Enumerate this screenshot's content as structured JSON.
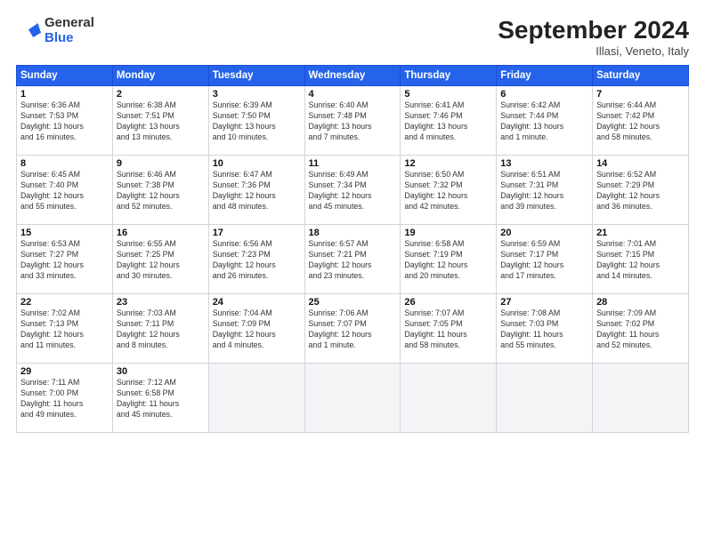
{
  "logo": {
    "general": "General",
    "blue": "Blue"
  },
  "header": {
    "title": "September 2024",
    "subtitle": "Illasi, Veneto, Italy"
  },
  "days_of_week": [
    "Sunday",
    "Monday",
    "Tuesday",
    "Wednesday",
    "Thursday",
    "Friday",
    "Saturday"
  ],
  "weeks": [
    [
      {
        "day": "1",
        "info": "Sunrise: 6:36 AM\nSunset: 7:53 PM\nDaylight: 13 hours\nand 16 minutes."
      },
      {
        "day": "2",
        "info": "Sunrise: 6:38 AM\nSunset: 7:51 PM\nDaylight: 13 hours\nand 13 minutes."
      },
      {
        "day": "3",
        "info": "Sunrise: 6:39 AM\nSunset: 7:50 PM\nDaylight: 13 hours\nand 10 minutes."
      },
      {
        "day": "4",
        "info": "Sunrise: 6:40 AM\nSunset: 7:48 PM\nDaylight: 13 hours\nand 7 minutes."
      },
      {
        "day": "5",
        "info": "Sunrise: 6:41 AM\nSunset: 7:46 PM\nDaylight: 13 hours\nand 4 minutes."
      },
      {
        "day": "6",
        "info": "Sunrise: 6:42 AM\nSunset: 7:44 PM\nDaylight: 13 hours\nand 1 minute."
      },
      {
        "day": "7",
        "info": "Sunrise: 6:44 AM\nSunset: 7:42 PM\nDaylight: 12 hours\nand 58 minutes."
      }
    ],
    [
      {
        "day": "8",
        "info": "Sunrise: 6:45 AM\nSunset: 7:40 PM\nDaylight: 12 hours\nand 55 minutes."
      },
      {
        "day": "9",
        "info": "Sunrise: 6:46 AM\nSunset: 7:38 PM\nDaylight: 12 hours\nand 52 minutes."
      },
      {
        "day": "10",
        "info": "Sunrise: 6:47 AM\nSunset: 7:36 PM\nDaylight: 12 hours\nand 48 minutes."
      },
      {
        "day": "11",
        "info": "Sunrise: 6:49 AM\nSunset: 7:34 PM\nDaylight: 12 hours\nand 45 minutes."
      },
      {
        "day": "12",
        "info": "Sunrise: 6:50 AM\nSunset: 7:32 PM\nDaylight: 12 hours\nand 42 minutes."
      },
      {
        "day": "13",
        "info": "Sunrise: 6:51 AM\nSunset: 7:31 PM\nDaylight: 12 hours\nand 39 minutes."
      },
      {
        "day": "14",
        "info": "Sunrise: 6:52 AM\nSunset: 7:29 PM\nDaylight: 12 hours\nand 36 minutes."
      }
    ],
    [
      {
        "day": "15",
        "info": "Sunrise: 6:53 AM\nSunset: 7:27 PM\nDaylight: 12 hours\nand 33 minutes."
      },
      {
        "day": "16",
        "info": "Sunrise: 6:55 AM\nSunset: 7:25 PM\nDaylight: 12 hours\nand 30 minutes."
      },
      {
        "day": "17",
        "info": "Sunrise: 6:56 AM\nSunset: 7:23 PM\nDaylight: 12 hours\nand 26 minutes."
      },
      {
        "day": "18",
        "info": "Sunrise: 6:57 AM\nSunset: 7:21 PM\nDaylight: 12 hours\nand 23 minutes."
      },
      {
        "day": "19",
        "info": "Sunrise: 6:58 AM\nSunset: 7:19 PM\nDaylight: 12 hours\nand 20 minutes."
      },
      {
        "day": "20",
        "info": "Sunrise: 6:59 AM\nSunset: 7:17 PM\nDaylight: 12 hours\nand 17 minutes."
      },
      {
        "day": "21",
        "info": "Sunrise: 7:01 AM\nSunset: 7:15 PM\nDaylight: 12 hours\nand 14 minutes."
      }
    ],
    [
      {
        "day": "22",
        "info": "Sunrise: 7:02 AM\nSunset: 7:13 PM\nDaylight: 12 hours\nand 11 minutes."
      },
      {
        "day": "23",
        "info": "Sunrise: 7:03 AM\nSunset: 7:11 PM\nDaylight: 12 hours\nand 8 minutes."
      },
      {
        "day": "24",
        "info": "Sunrise: 7:04 AM\nSunset: 7:09 PM\nDaylight: 12 hours\nand 4 minutes."
      },
      {
        "day": "25",
        "info": "Sunrise: 7:06 AM\nSunset: 7:07 PM\nDaylight: 12 hours\nand 1 minute."
      },
      {
        "day": "26",
        "info": "Sunrise: 7:07 AM\nSunset: 7:05 PM\nDaylight: 11 hours\nand 58 minutes."
      },
      {
        "day": "27",
        "info": "Sunrise: 7:08 AM\nSunset: 7:03 PM\nDaylight: 11 hours\nand 55 minutes."
      },
      {
        "day": "28",
        "info": "Sunrise: 7:09 AM\nSunset: 7:02 PM\nDaylight: 11 hours\nand 52 minutes."
      }
    ],
    [
      {
        "day": "29",
        "info": "Sunrise: 7:11 AM\nSunset: 7:00 PM\nDaylight: 11 hours\nand 49 minutes."
      },
      {
        "day": "30",
        "info": "Sunrise: 7:12 AM\nSunset: 6:58 PM\nDaylight: 11 hours\nand 45 minutes."
      },
      {
        "day": "",
        "info": ""
      },
      {
        "day": "",
        "info": ""
      },
      {
        "day": "",
        "info": ""
      },
      {
        "day": "",
        "info": ""
      },
      {
        "day": "",
        "info": ""
      }
    ]
  ]
}
